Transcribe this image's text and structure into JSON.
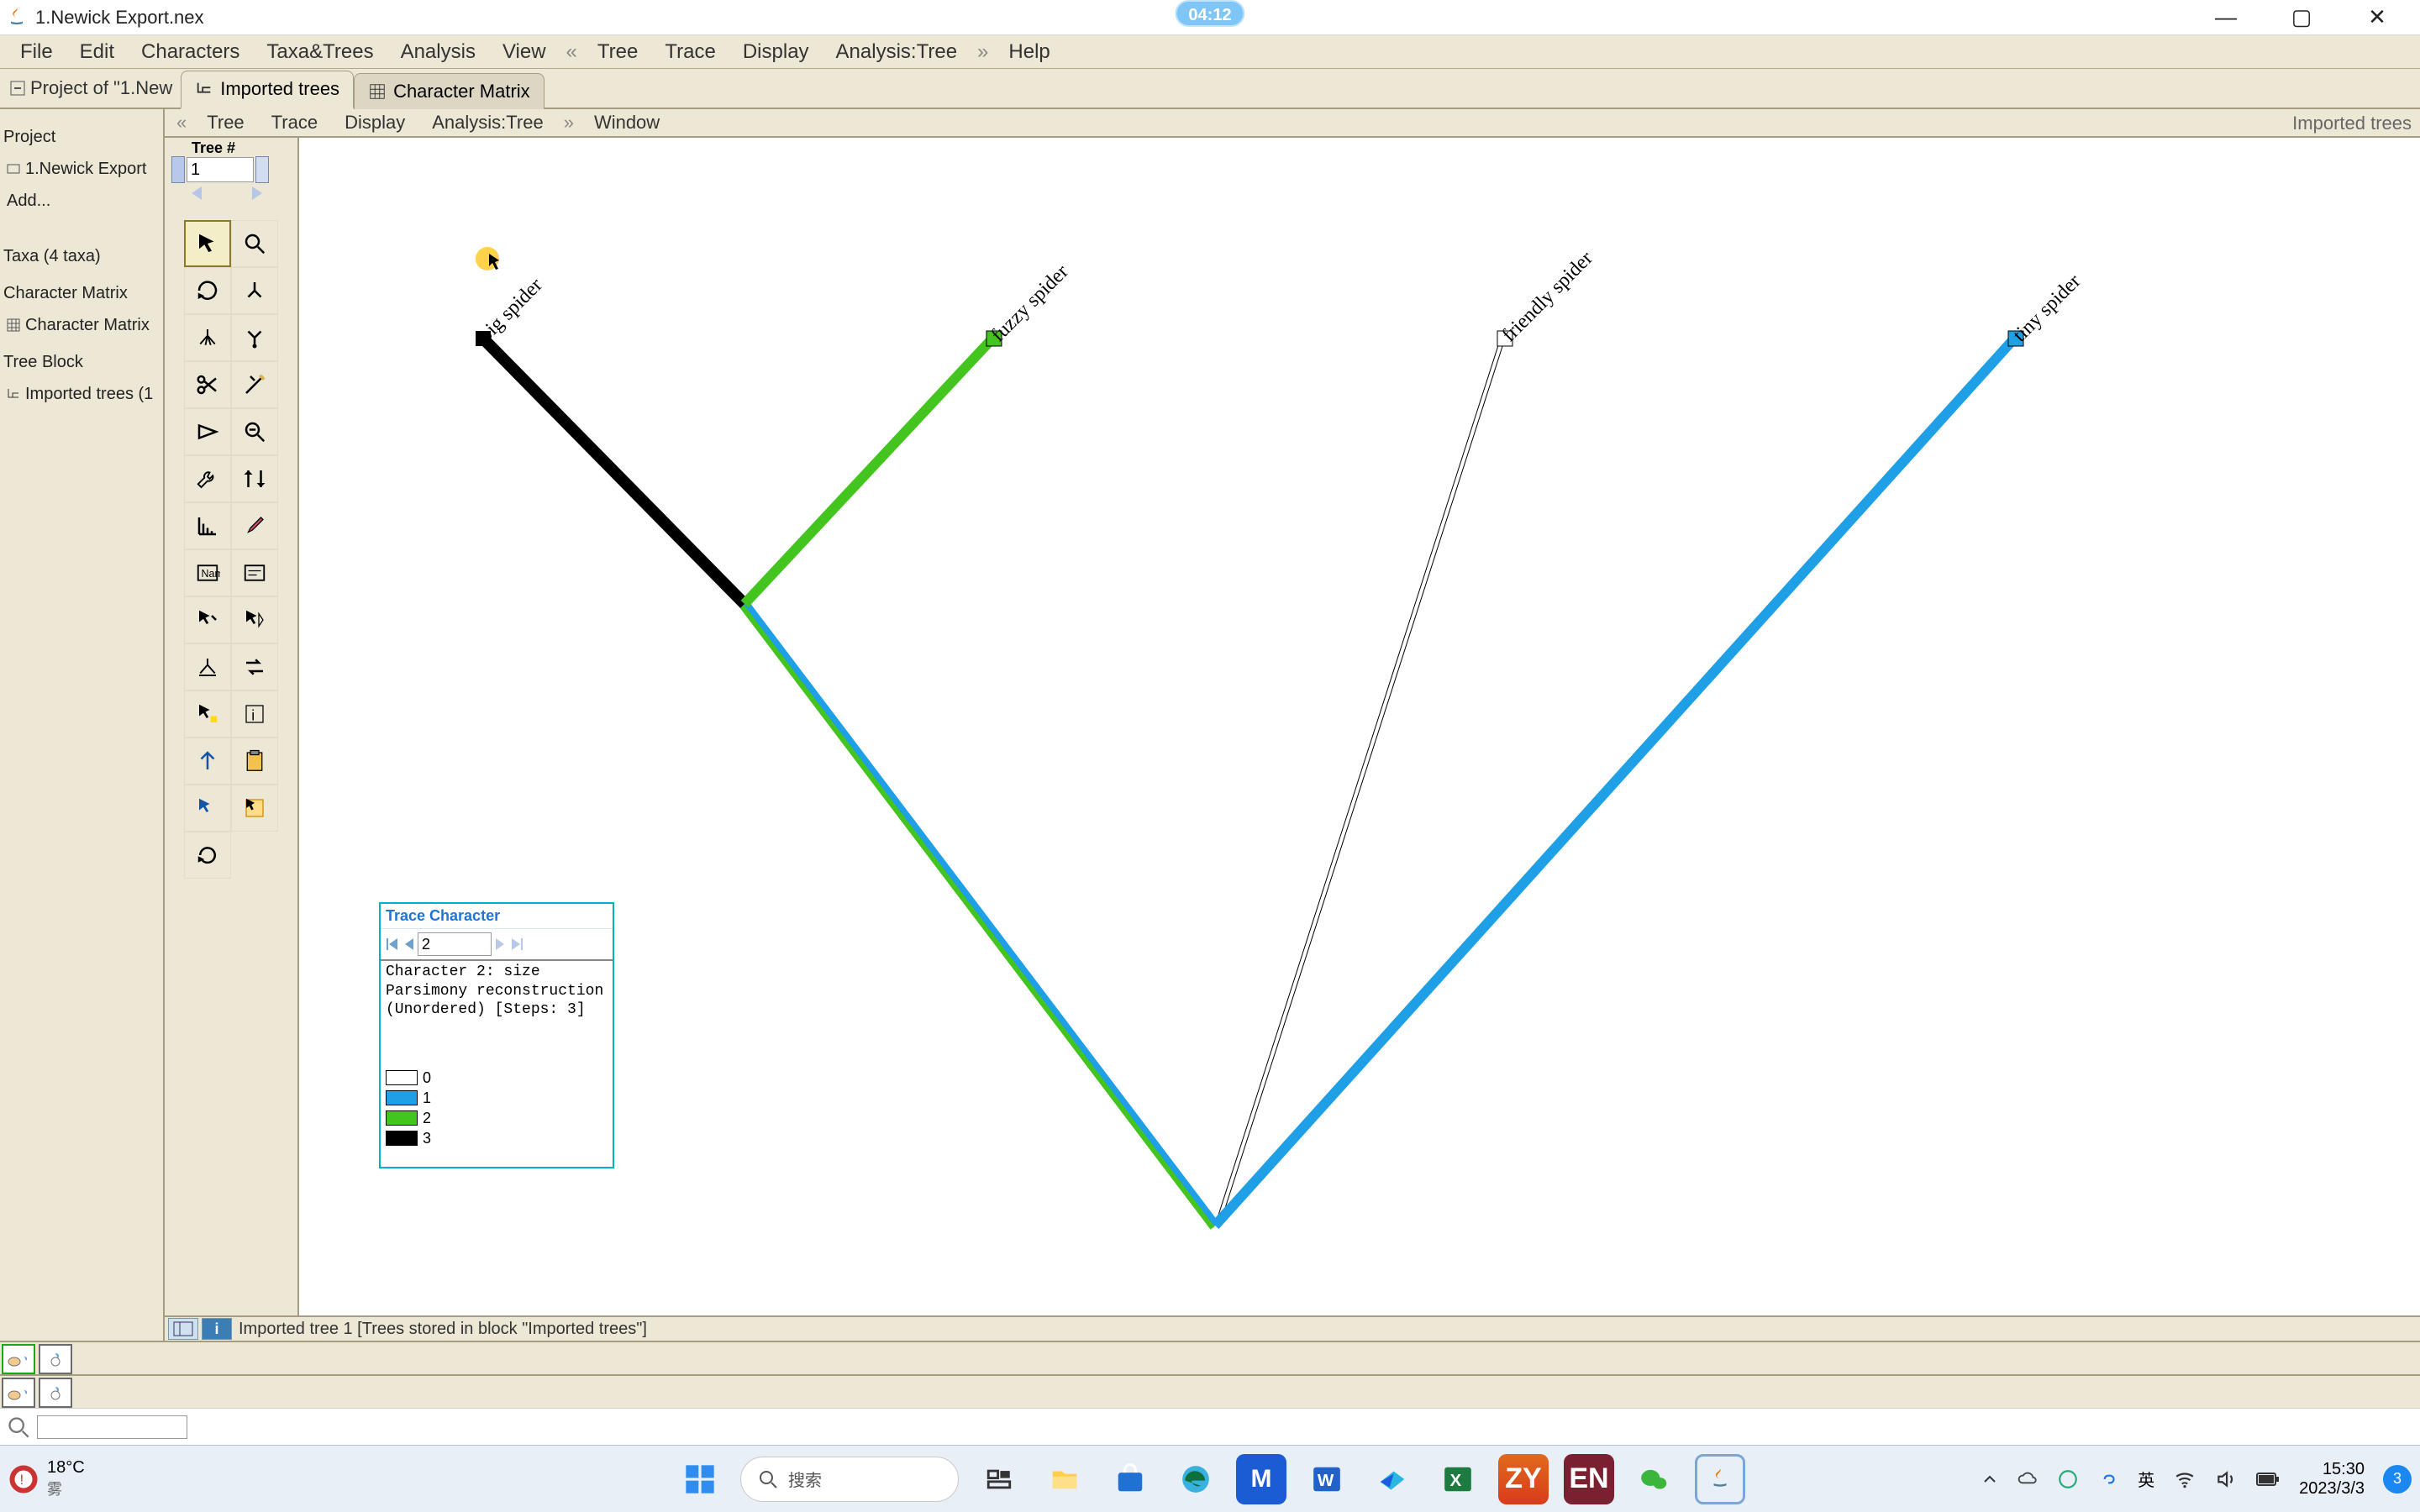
{
  "window": {
    "title": "1.Newick Export.nex",
    "time_bubble": "04:12"
  },
  "menubar": [
    "File",
    "Edit",
    "Characters",
    "Taxa&Trees",
    "Analysis",
    "View",
    "«",
    "Tree",
    "Trace",
    "Display",
    "Analysis:Tree",
    "»",
    "Help"
  ],
  "projtabs": {
    "project_label": "Project of \"1.New",
    "tabs": [
      {
        "label": "Imported trees",
        "active": true
      },
      {
        "label": "Character Matrix",
        "active": false
      }
    ]
  },
  "sidebar": {
    "project": "Project",
    "items": [
      "1.Newick Export",
      "Add...",
      "Taxa (4 taxa)",
      "Character Matrix",
      "Character Matrix",
      "Tree Block",
      "Imported trees (1"
    ]
  },
  "tree_menubar": [
    "«",
    "Tree",
    "Trace",
    "Display",
    "Analysis:Tree",
    "»",
    "Window"
  ],
  "imported_label": "Imported trees",
  "tree_number": {
    "label": "Tree #",
    "value": "1"
  },
  "taxa": [
    "big spider",
    "fuzzy spider",
    "friendly spider",
    "tiny spider"
  ],
  "trace_panel": {
    "title": "Trace Character",
    "char_index": "2",
    "desc": "Character 2: size\nParsimony reconstruction\n(Unordered) [Steps: 3]",
    "legend": [
      {
        "label": "0",
        "color": "#ffffff"
      },
      {
        "label": "1",
        "color": "#1e9fe6"
      },
      {
        "label": "2",
        "color": "#43c41e"
      },
      {
        "label": "3",
        "color": "#000000"
      }
    ]
  },
  "bottominfo": "Imported tree 1     [Trees stored in block \"Imported trees\"]",
  "taskbar": {
    "weather_temp": "18°C",
    "weather_desc": "雾",
    "search_placeholder": "搜索",
    "ime": "英",
    "clock_time": "15:30",
    "clock_date": "2023/3/3",
    "notif": "3"
  }
}
